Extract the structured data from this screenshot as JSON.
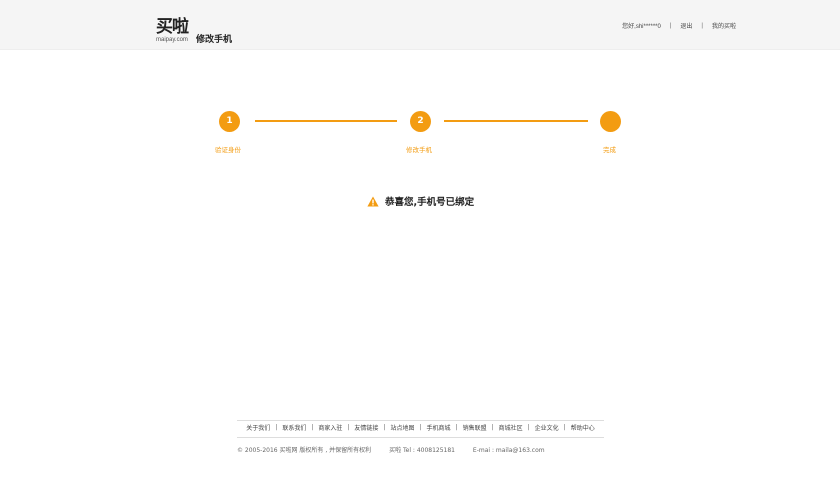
{
  "header": {
    "logo_main": "买啦",
    "logo_sub": "maipay.com",
    "page_title": "修改手机",
    "greeting": "您好,shi******0",
    "logout_label": "退出",
    "my_account_label": "我的买啦",
    "separator": "|"
  },
  "steps": [
    {
      "number": "1",
      "label": "验证身份"
    },
    {
      "number": "2",
      "label": "修改手机"
    },
    {
      "number": "",
      "label": "完成"
    }
  ],
  "message": {
    "icon": "warning-triangle-icon",
    "text": "恭喜您,手机号已绑定"
  },
  "footer": {
    "links": [
      "关于我们",
      "联系我们",
      "商家入驻",
      "友情链接",
      "站点地图",
      "手机商城",
      "销售联盟",
      "商城社区",
      "企业文化",
      "帮助中心"
    ],
    "separator": "|",
    "copyright": "© 2005-2016 买啦网 版权所有 , 并保留所有权利",
    "tel": "买啦 Tel : 4008125181",
    "email": "E-mai : maila@163.com"
  },
  "colors": {
    "accent": "#f39c12",
    "header_bg": "#f5f5f5"
  }
}
